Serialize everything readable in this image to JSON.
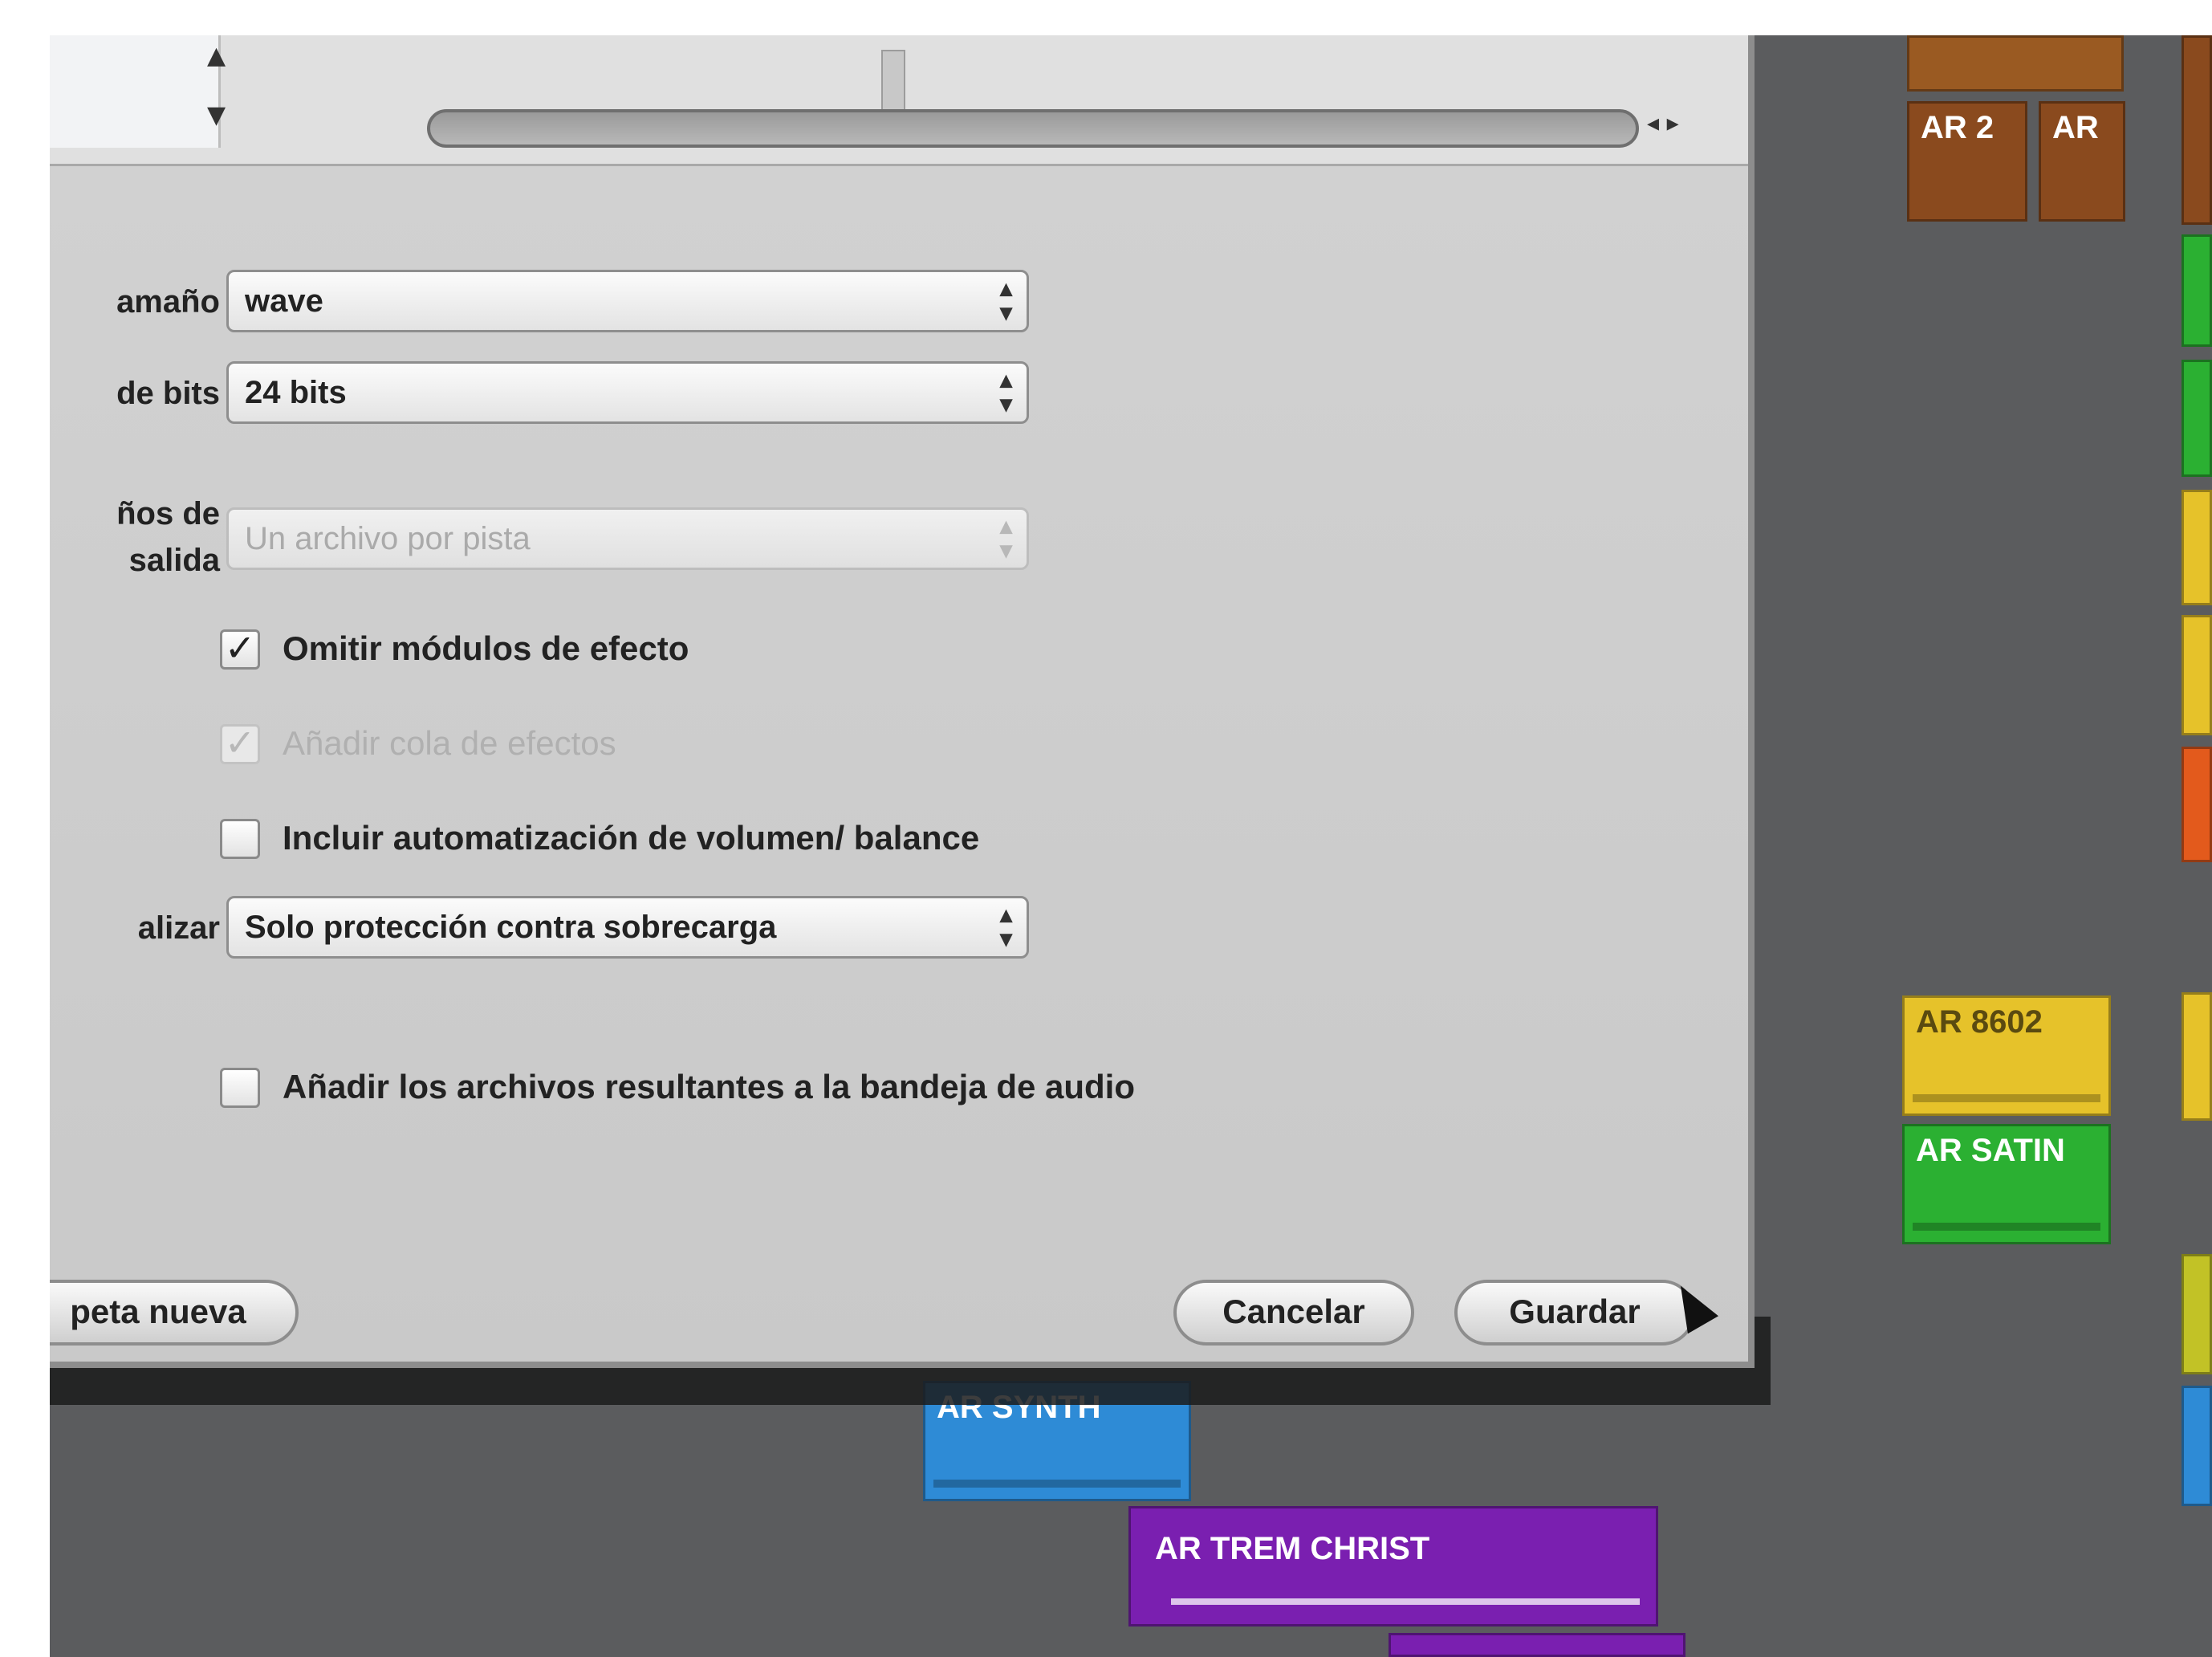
{
  "dialog": {
    "labels": {
      "size": "amaño",
      "bits": "de bits",
      "output_files_1": "ños de",
      "output_files_2": "salida",
      "dither": "alizar"
    },
    "selects": {
      "size_value": "wave",
      "bits_value": "24 bits",
      "output_files_value": "Un archivo por pista",
      "dither_value": "Solo protección contra sobrecarga"
    },
    "checkboxes": {
      "omit_effects": "Omitir módulos de efecto",
      "add_effect_tail": "Añadir cola de efectos",
      "include_automation": "Incluir automatización de volumen/ balance",
      "add_to_audio_bin": "Añadir los archivos resultantes a la bandeja de audio"
    },
    "buttons": {
      "new_folder": "peta nueva",
      "cancel": "Cancelar",
      "save": "Guardar"
    },
    "browser": {
      "arrow_up": "▲",
      "arrow_down": "▼",
      "scroll_buttons": "◂ ▸"
    }
  },
  "regions": {
    "r1": "AR 8602",
    "r2": "AR SATIN",
    "r3": "AR TREM CHRIST",
    "r4": "AR SYNTH",
    "brown1": "AR 2",
    "brown2": "AR"
  },
  "colors": {
    "arrange_bg": "#5b5c5e",
    "blue": "#2e8bd6",
    "purple": "#7a1fb0",
    "green": "#2bb032",
    "yellow": "#e6c22a",
    "orange": "#e35a1c",
    "brown": "#8a4a1e"
  }
}
